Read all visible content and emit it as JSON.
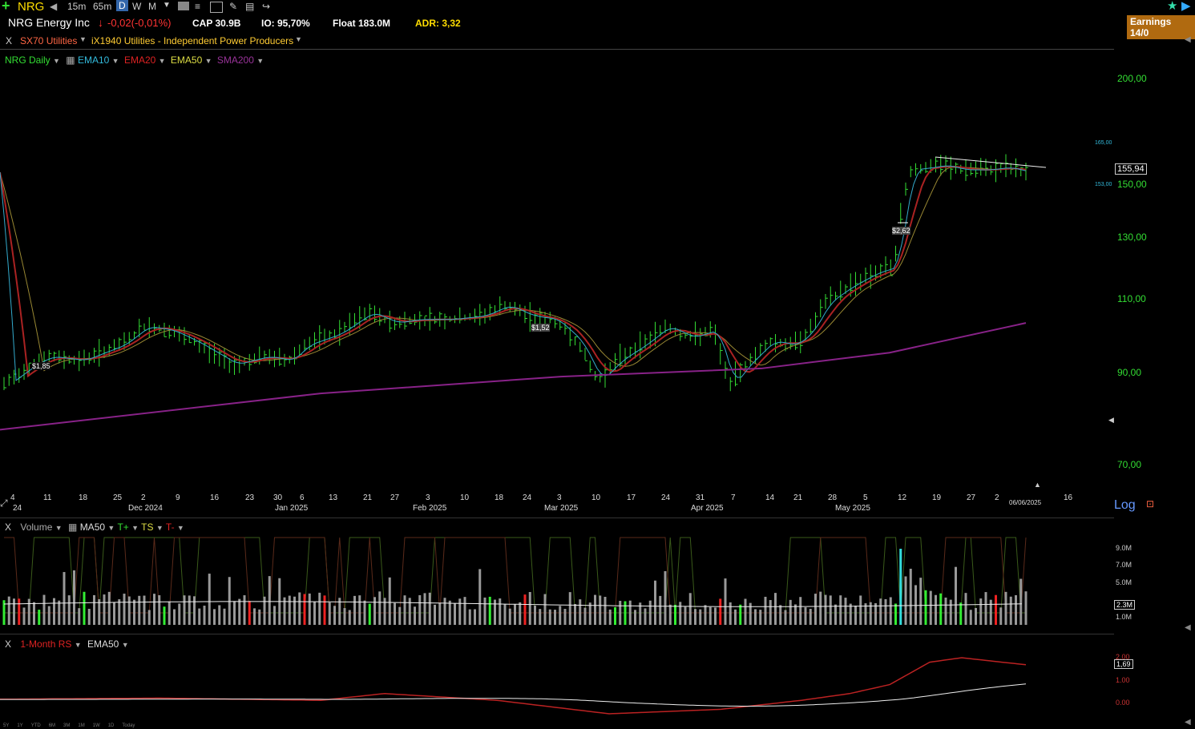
{
  "toolbar": {
    "symbol": "NRG",
    "timeframes": [
      "15m",
      "65m",
      "D",
      "W",
      "M"
    ],
    "active_timeframe": "D"
  },
  "info": {
    "company": "NRG Energy Inc",
    "change": "-0,02(-0,01%)",
    "cap": "CAP 30.9B",
    "io": "IO: 95,70%",
    "float": "Float 183.0M",
    "adr": "ADR: 3,32",
    "earnings": "Earnings 14/0"
  },
  "sector": {
    "close": "X",
    "sector": "SX70 Utilities",
    "industry": "iX1940 Utilities - Independent Power Producers"
  },
  "price_legend": {
    "series": [
      {
        "label": "NRG Daily",
        "color": "#33dd33"
      },
      {
        "label": "EMA10",
        "color": "#33bbdd"
      },
      {
        "label": "EMA20",
        "color": "#dd2222"
      },
      {
        "label": "EMA50",
        "color": "#dddd44"
      },
      {
        "label": "SMA200",
        "color": "#993399"
      }
    ]
  },
  "price_axis": {
    "ticks": [
      "200,00",
      "150,00",
      "130,00",
      "110,00",
      "90,00",
      "70,00"
    ],
    "current": "155,94",
    "upper_small": "165,00",
    "lower_small": "153,00",
    "log_label": "Log"
  },
  "annotations": [
    "$1,85",
    "$1,52",
    "$2,62"
  ],
  "x_axis": {
    "days": [
      "4",
      "11",
      "18",
      "25",
      "2",
      "9",
      "16",
      "23",
      "30",
      "6",
      "13",
      "21",
      "27",
      "3",
      "10",
      "18",
      "24",
      "3",
      "10",
      "17",
      "24",
      "31",
      "7",
      "14",
      "21",
      "28",
      "5",
      "12",
      "19",
      "27",
      "2",
      "16"
    ],
    "months": [
      "24",
      "Dec 2024",
      "Jan 2025",
      "Feb 2025",
      "Mar 2025",
      "Apr 2025",
      "May 2025"
    ],
    "date_marker": "06/06/2025"
  },
  "volume_pane": {
    "close": "X",
    "label": "Volume",
    "ma": "MA50",
    "t_plus": "T+",
    "ts": "TS",
    "t_minus": "T-",
    "ticks": [
      "9.0M",
      "7.0M",
      "5.0M",
      "2.3M",
      "1.0M"
    ]
  },
  "rs_pane": {
    "close": "X",
    "label": "1-Month RS",
    "ema": "EMA50",
    "ticks": [
      "2.00",
      "1,69",
      "1.00",
      "0.00"
    ]
  },
  "bottom_ranges": [
    "5Y",
    "1Y",
    "YTD",
    "6M",
    "3M",
    "1M",
    "1W",
    "1D",
    "Today"
  ]
}
